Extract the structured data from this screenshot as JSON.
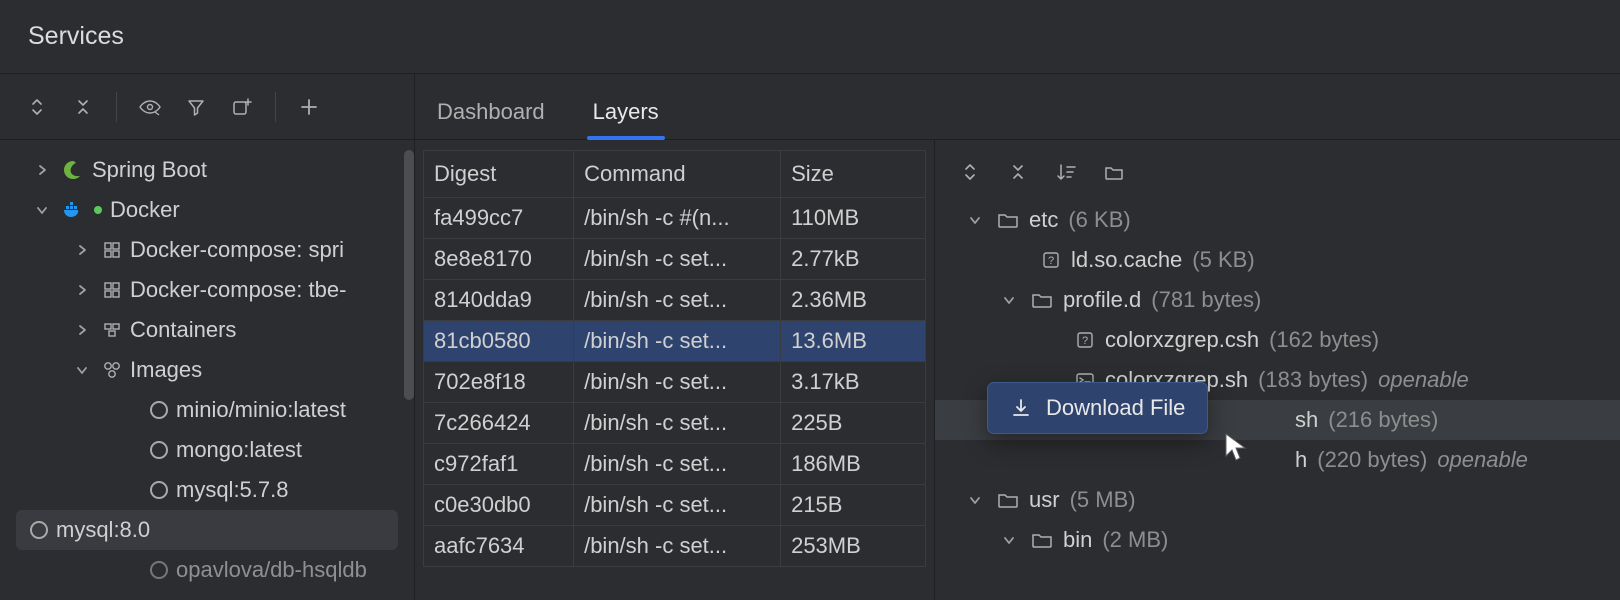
{
  "panel_title": "Services",
  "sidebar": {
    "spring_label": "Spring Boot",
    "docker_label": "Docker",
    "compose1_label": "Docker-compose: spri",
    "compose2_label": "Docker-compose: tbe-",
    "containers_label": "Containers",
    "images_label": "Images",
    "images": [
      "minio/minio:latest",
      "mongo:latest",
      "mysql:5.7.8",
      "mysql:8.0",
      "opavlova/db-hsqldb"
    ]
  },
  "tabs": {
    "dashboard": "Dashboard",
    "layers": "Layers"
  },
  "table": {
    "headers": {
      "digest": "Digest",
      "command": "Command",
      "size": "Size"
    },
    "rows": [
      {
        "digest": "fa499cc7",
        "command": "/bin/sh -c #(n...",
        "size": "110MB"
      },
      {
        "digest": "8e8e8170",
        "command": "/bin/sh -c set...",
        "size": "2.77kB"
      },
      {
        "digest": "8140dda9",
        "command": "/bin/sh -c set...",
        "size": "2.36MB"
      },
      {
        "digest": "81cb0580",
        "command": "/bin/sh -c set...",
        "size": "13.6MB"
      },
      {
        "digest": "702e8f18",
        "command": "/bin/sh -c set...",
        "size": "3.17kB"
      },
      {
        "digest": "7c266424",
        "command": "/bin/sh -c set...",
        "size": "225B"
      },
      {
        "digest": "c972faf1",
        "command": "/bin/sh -c set...",
        "size": "186MB"
      },
      {
        "digest": "c0e30db0",
        "command": "/bin/sh -c set...",
        "size": "215B"
      },
      {
        "digest": "aafc7634",
        "command": "/bin/sh -c set...",
        "size": "253MB"
      }
    ],
    "selected_index": 3
  },
  "filetree": {
    "etc": {
      "name": "etc",
      "size": "(6 KB)"
    },
    "ld_cache": {
      "name": "ld.so.cache",
      "size": "(5 KB)"
    },
    "profiled": {
      "name": "profile.d",
      "size": "(781 bytes)"
    },
    "csh": {
      "name": "colorxzgrep.csh",
      "size": "(162 bytes)"
    },
    "sh": {
      "name": "colorxzgrep.sh",
      "size": "(183 bytes)",
      "openable": "openable"
    },
    "shhidden1": {
      "name": "sh",
      "size": "(216 bytes)"
    },
    "shhidden2": {
      "name": "h",
      "size": "(220 bytes)",
      "openable": "openable"
    },
    "usr": {
      "name": "usr",
      "size": "(5 MB)"
    },
    "bin": {
      "name": "bin",
      "size": "(2 MB)"
    }
  },
  "context_menu": {
    "download": "Download File"
  }
}
